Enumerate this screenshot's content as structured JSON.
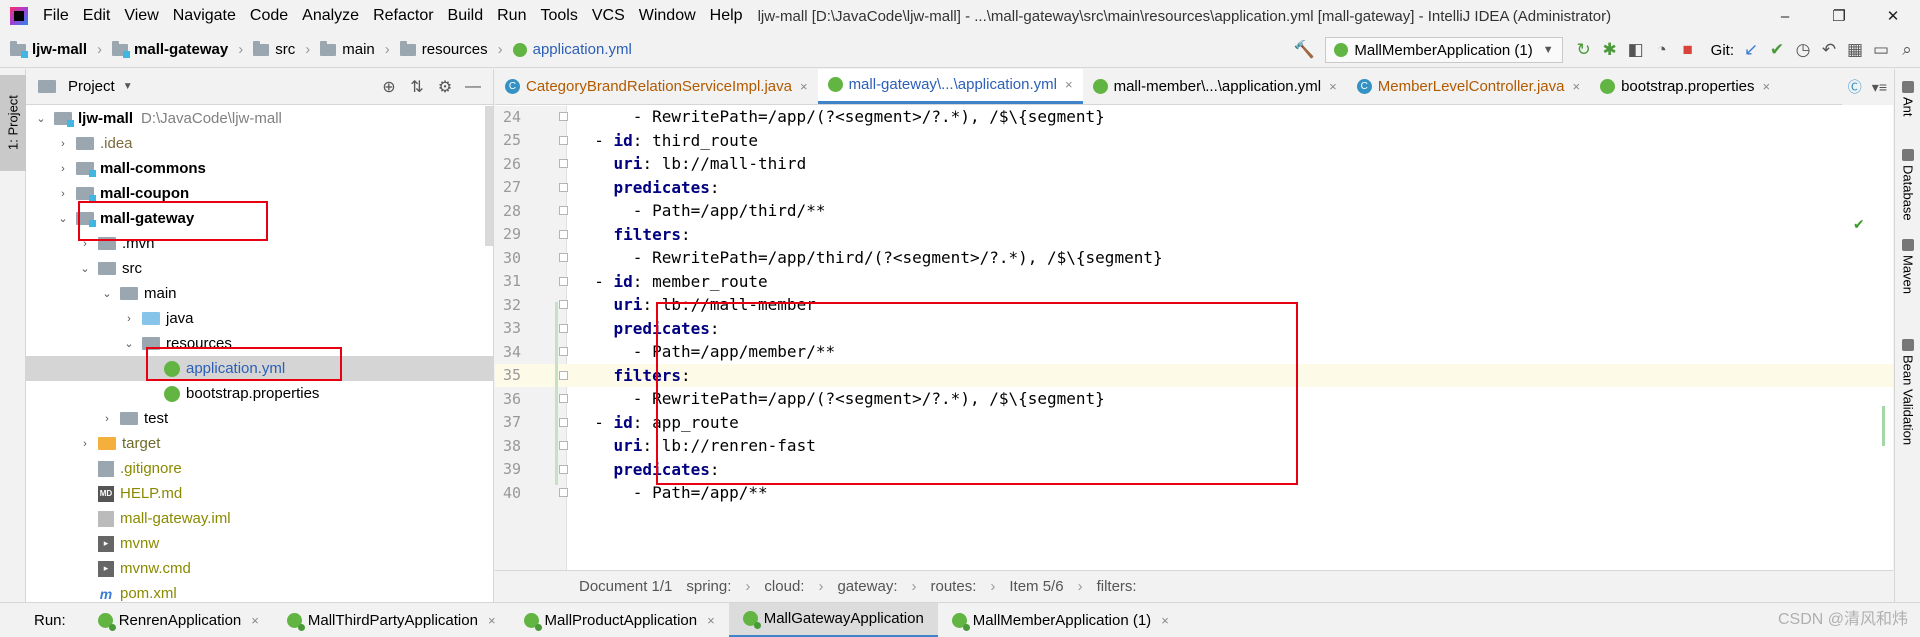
{
  "menu": {
    "items": [
      "File",
      "Edit",
      "View",
      "Navigate",
      "Code",
      "Analyze",
      "Refactor",
      "Build",
      "Run",
      "Tools",
      "VCS",
      "Window",
      "Help"
    ],
    "window_title": "ljw-mall [D:\\JavaCode\\ljw-mall] - ...\\mall-gateway\\src\\main\\resources\\application.yml [mall-gateway] - IntelliJ IDEA (Administrator)"
  },
  "window_controls": {
    "minimize": "–",
    "restore": "❐",
    "close": "✕"
  },
  "navbar": {
    "crumbs": [
      "ljw-mall",
      "mall-gateway",
      "src",
      "main",
      "resources",
      "application.yml"
    ],
    "run_config": "MallMemberApplication (1)",
    "git_label": "Git:"
  },
  "left_stripe": {
    "project_tab": "1: Project"
  },
  "project_panel": {
    "title": "Project",
    "tree": [
      {
        "label": "ljw-mall",
        "path": "D:\\JavaCode\\ljw-mall",
        "icon": "module-folder-icon",
        "arrow": "▾",
        "level": 0,
        "style": "bold"
      },
      {
        "label": ".idea",
        "icon": "folder-icon",
        "arrow": "▸",
        "level": 1,
        "style": "dim"
      },
      {
        "label": "mall-commons",
        "icon": "module-folder-icon",
        "arrow": "▸",
        "level": 1,
        "style": "bold"
      },
      {
        "label": "mall-coupon",
        "icon": "module-folder-icon",
        "arrow": "▸",
        "level": 1,
        "style": "bold"
      },
      {
        "label": "mall-gateway",
        "icon": "module-folder-icon",
        "arrow": "▾",
        "level": 1,
        "style": "bold"
      },
      {
        "label": ".mvn",
        "icon": "folder-icon",
        "arrow": "▸",
        "level": 2,
        "style": "normal"
      },
      {
        "label": "src",
        "icon": "folder-icon",
        "arrow": "▾",
        "level": 2,
        "style": "normal"
      },
      {
        "label": "main",
        "icon": "folder-icon",
        "arrow": "▾",
        "level": 3,
        "style": "normal"
      },
      {
        "label": "java",
        "icon": "source-folder-icon",
        "arrow": "▸",
        "level": 4,
        "style": "normal"
      },
      {
        "label": "resources",
        "icon": "resources-folder-icon",
        "arrow": "▾",
        "level": 4,
        "style": "normal"
      },
      {
        "label": "application.yml",
        "icon": "spring-yml-icon",
        "arrow": "",
        "level": 5,
        "style": "blue",
        "selected": true
      },
      {
        "label": "bootstrap.properties",
        "icon": "spring-yml-icon",
        "arrow": "",
        "level": 5,
        "style": "normal"
      },
      {
        "label": "test",
        "icon": "folder-icon",
        "arrow": "▸",
        "level": 3,
        "style": "normal"
      },
      {
        "label": "target",
        "icon": "excluded-folder-icon",
        "arrow": "▸",
        "level": 2,
        "style": "olive"
      },
      {
        "label": ".gitignore",
        "icon": "gitignore-icon",
        "arrow": "",
        "level": 2,
        "style": "ignored"
      },
      {
        "label": "HELP.md",
        "icon": "markdown-icon",
        "arrow": "",
        "level": 2,
        "style": "ignored"
      },
      {
        "label": "mall-gateway.iml",
        "icon": "iml-icon",
        "arrow": "",
        "level": 2,
        "style": "ignored"
      },
      {
        "label": "mvnw",
        "icon": "shell-icon",
        "arrow": "",
        "level": 2,
        "style": "ignored"
      },
      {
        "label": "mvnw.cmd",
        "icon": "shell-icon",
        "arrow": "",
        "level": 2,
        "style": "ignored"
      },
      {
        "label": "pom.xml",
        "icon": "maven-icon",
        "arrow": "",
        "level": 2,
        "style": "ignored"
      }
    ]
  },
  "editor": {
    "tabs": [
      {
        "label": "CategoryBrandRelationServiceImpl.java",
        "icon": "class-icon",
        "style": "orange",
        "active": false
      },
      {
        "label": "mall-gateway\\...\\application.yml",
        "icon": "spring-yml-icon",
        "style": "blue",
        "active": true
      },
      {
        "label": "mall-member\\...\\application.yml",
        "icon": "spring-yml-icon",
        "style": "normal",
        "active": false
      },
      {
        "label": "MemberLevelController.java",
        "icon": "class-icon",
        "style": "orange",
        "active": false
      },
      {
        "label": "bootstrap.properties",
        "icon": "spring-yml-icon",
        "style": "normal",
        "active": false
      }
    ],
    "lines": [
      {
        "num": "24",
        "indent": "      ",
        "dash": "- ",
        "key": "",
        "value": "RewritePath=/app/(?<segment>/?.*), /$\\{segment}"
      },
      {
        "num": "25",
        "indent": "  ",
        "dash": "- ",
        "key": "id",
        "value": "third_route"
      },
      {
        "num": "26",
        "indent": "    ",
        "dash": "",
        "key": "uri",
        "value": "lb://mall-third"
      },
      {
        "num": "27",
        "indent": "    ",
        "dash": "",
        "key": "predicates",
        "value": ""
      },
      {
        "num": "28",
        "indent": "      ",
        "dash": "- ",
        "key": "",
        "value": "Path=/app/third/**"
      },
      {
        "num": "29",
        "indent": "    ",
        "dash": "",
        "key": "filters",
        "value": ""
      },
      {
        "num": "30",
        "indent": "      ",
        "dash": "- ",
        "key": "",
        "value": "RewritePath=/app/third/(?<segment>/?.*), /$\\{segment}"
      },
      {
        "num": "31",
        "indent": "  ",
        "dash": "- ",
        "key": "id",
        "value": "member_route"
      },
      {
        "num": "32",
        "indent": "    ",
        "dash": "",
        "key": "uri",
        "value": "lb://mall-member"
      },
      {
        "num": "33",
        "indent": "    ",
        "dash": "",
        "key": "predicates",
        "value": ""
      },
      {
        "num": "34",
        "indent": "      ",
        "dash": "- ",
        "key": "",
        "value": "Path=/app/member/**"
      },
      {
        "num": "35",
        "indent": "    ",
        "dash": "",
        "key": "filters",
        "value": "",
        "current": true
      },
      {
        "num": "36",
        "indent": "      ",
        "dash": "- ",
        "key": "",
        "value": "RewritePath=/app/(?<segment>/?.*), /$\\{segment}"
      },
      {
        "num": "37",
        "indent": "  ",
        "dash": "- ",
        "key": "id",
        "value": "app_route"
      },
      {
        "num": "38",
        "indent": "    ",
        "dash": "",
        "key": "uri",
        "value": "lb://renren-fast"
      },
      {
        "num": "39",
        "indent": "    ",
        "dash": "",
        "key": "predicates",
        "value": ""
      },
      {
        "num": "40",
        "indent": "      ",
        "dash": "- ",
        "key": "",
        "value": "Path=/app/**"
      }
    ],
    "breadcrumb": [
      "Document 1/1",
      "spring:",
      "cloud:",
      "gateway:",
      "routes:",
      "Item 5/6",
      "filters:"
    ]
  },
  "right_stripe": [
    "Ant",
    "Database",
    "Maven",
    "Bean Validation"
  ],
  "run_bar": {
    "label": "Run:",
    "tabs": [
      {
        "label": "RenrenApplication",
        "active": false,
        "closable": true
      },
      {
        "label": "MallThirdPartyApplication",
        "active": false,
        "closable": true
      },
      {
        "label": "MallProductApplication",
        "active": false,
        "closable": true
      },
      {
        "label": "MallGatewayApplication",
        "active": true,
        "closable": false
      },
      {
        "label": "MallMemberApplication (1)",
        "active": false,
        "closable": true
      }
    ]
  },
  "watermark": "CSDN @清风和炜",
  "colors": {
    "accent": "#4083c9",
    "highlight_box": "#e60012",
    "yaml_key": "#000080"
  }
}
